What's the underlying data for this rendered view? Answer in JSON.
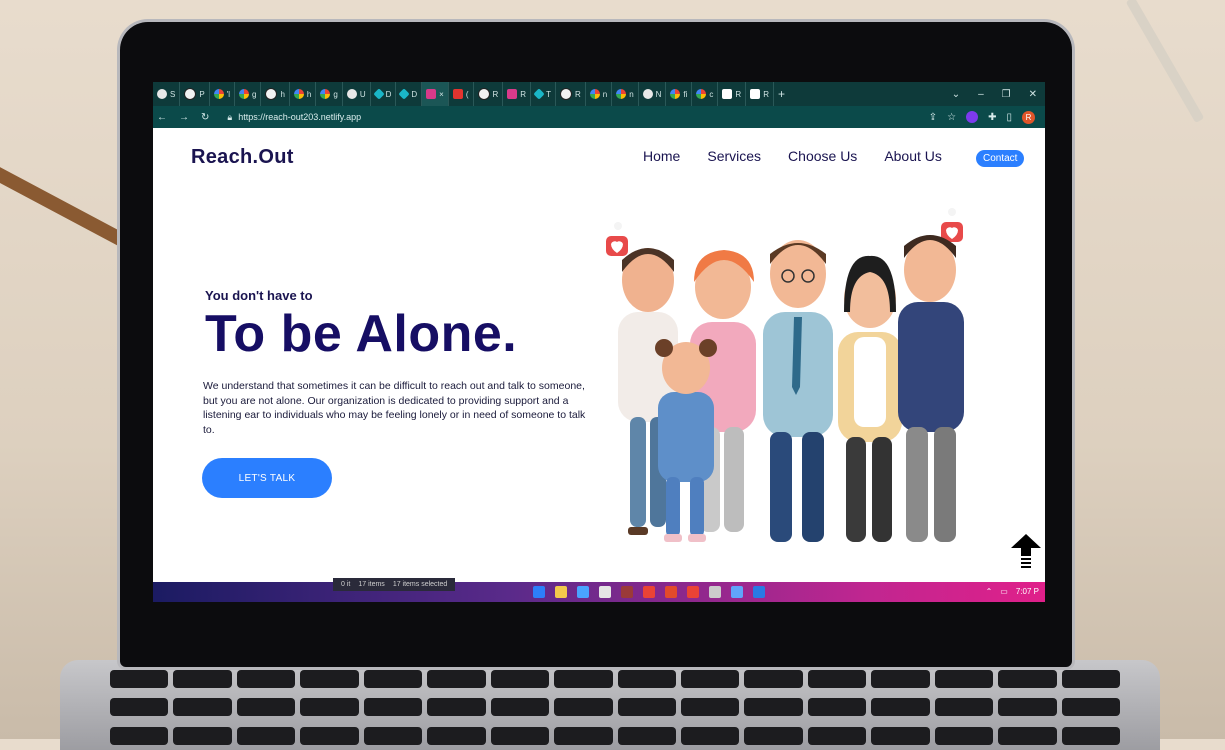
{
  "browser": {
    "tabs": [
      {
        "label": "S",
        "icon": "generic-icon"
      },
      {
        "label": "P",
        "icon": "github-icon"
      },
      {
        "label": "'l",
        "icon": "google-icon"
      },
      {
        "label": "g",
        "icon": "google-icon"
      },
      {
        "label": "h",
        "icon": "github-icon"
      },
      {
        "label": "h",
        "icon": "google-icon"
      },
      {
        "label": "g",
        "icon": "google-icon"
      },
      {
        "label": "U",
        "icon": "generic-icon"
      },
      {
        "label": "D",
        "icon": "diamond-icon"
      },
      {
        "label": "D",
        "icon": "diamond-icon"
      },
      {
        "label": "×",
        "icon": "pink-icon",
        "active": true
      },
      {
        "label": "(",
        "icon": "red-icon"
      },
      {
        "label": "R",
        "icon": "github-icon"
      },
      {
        "label": "R",
        "icon": "pink-icon"
      },
      {
        "label": "T",
        "icon": "diamond-icon"
      },
      {
        "label": "R",
        "icon": "github-icon"
      },
      {
        "label": "n",
        "icon": "google-icon"
      },
      {
        "label": "n",
        "icon": "google-icon"
      },
      {
        "label": "N",
        "icon": "generic-icon"
      },
      {
        "label": "fi",
        "icon": "google-icon"
      },
      {
        "label": "c",
        "icon": "google-icon"
      },
      {
        "label": "R",
        "icon": "r-icon"
      },
      {
        "label": "R",
        "icon": "r-icon"
      }
    ],
    "new_tab": "+",
    "controls": {
      "dropdown": "⌄",
      "minimize": "–",
      "maximize": "❐",
      "close": "✕"
    },
    "url": "https://reach-out203.netlify.app",
    "profile_initial": "R"
  },
  "site": {
    "logo": "Reach.Out",
    "nav": [
      "Home",
      "Services",
      "Choose Us",
      "About Us"
    ],
    "contact_label": "Contact",
    "hero": {
      "subtitle": "You don't have to",
      "title": "To be Alone.",
      "body": "We understand that sometimes it can be difficult to reach out and talk to someone, but you are not alone. Our organization is dedicated to providing support and a listening ear to individuals who may be feeling lonely or in need of someone to talk to.",
      "cta": "LET'S TALK"
    }
  },
  "taskbar": {
    "explorer_status": [
      "0 it",
      "17 items",
      "17 items selected"
    ],
    "time": "7:07 P",
    "tray_icons": [
      "chevron-up-icon",
      "network-icon"
    ],
    "app_colors": [
      "#2d7ff9",
      "#f2c94c",
      "#4aa3ff",
      "#e5e5e5",
      "#9b3a3a",
      "#ea4335",
      "#e24a2b",
      "#ea4335",
      "#cccccc",
      "#60a5fa",
      "#2a7ae4"
    ]
  },
  "colors": {
    "brand_navy": "#160e64",
    "accent_blue": "#2b7fff",
    "chrome_teal": "#0e3a3a"
  }
}
